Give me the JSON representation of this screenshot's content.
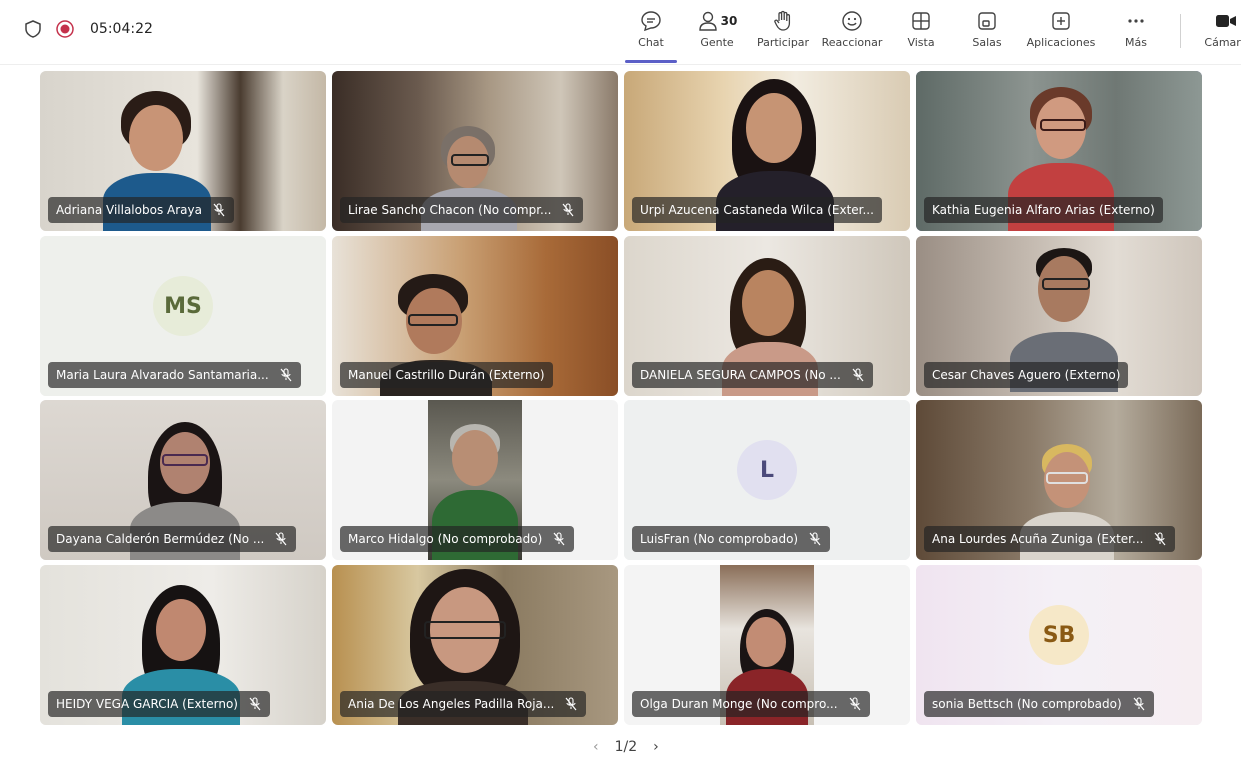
{
  "header": {
    "timer": "05:04:22",
    "people_count": "30",
    "toolbar": [
      {
        "label": "Chat",
        "icon": "chat-icon"
      },
      {
        "label": "Gente",
        "icon": "people-icon"
      },
      {
        "label": "Participar",
        "icon": "raise-hand-icon"
      },
      {
        "label": "Reaccionar",
        "icon": "react-icon"
      },
      {
        "label": "Vista",
        "icon": "view-icon"
      },
      {
        "label": "Salas",
        "icon": "rooms-icon"
      },
      {
        "label": "Aplicaciones",
        "icon": "apps-icon"
      },
      {
        "label": "Más",
        "icon": "more-icon"
      },
      {
        "label": "Cámara",
        "icon": "camera-icon"
      }
    ]
  },
  "participants": [
    {
      "name": "Adriana Villalobos Araya",
      "muted": true
    },
    {
      "name": "Lirae Sancho Chacon (No compr...",
      "muted": true
    },
    {
      "name": "Urpi Azucena Castaneda Wilca (Exter...",
      "muted": false
    },
    {
      "name": "Kathia Eugenia Alfaro Arias (Externo)",
      "muted": false
    },
    {
      "name": "Maria Laura Alvarado Santamaria...",
      "muted": true,
      "initials": "MS"
    },
    {
      "name": "Manuel Castrillo Durán (Externo)",
      "muted": false
    },
    {
      "name": "DANIELA SEGURA CAMPOS (No ...",
      "muted": true
    },
    {
      "name": "Cesar Chaves Aguero (Externo)",
      "muted": false
    },
    {
      "name": "Dayana Calderón Bermúdez (No ...",
      "muted": true
    },
    {
      "name": "Marco Hidalgo (No comprobado)",
      "muted": true
    },
    {
      "name": "LuisFran (No comprobado)",
      "muted": true,
      "initials": "L"
    },
    {
      "name": "Ana Lourdes Acuña Zuniga (Exter...",
      "muted": true
    },
    {
      "name": "HEIDY VEGA GARCIA (Externo)",
      "muted": true
    },
    {
      "name": "Ania De Los Angeles Padilla Roja...",
      "muted": true
    },
    {
      "name": "Olga Duran Monge (No compro...",
      "muted": true
    },
    {
      "name": "sonia Bettsch (No comprobado)",
      "muted": true,
      "initials": "SB"
    }
  ],
  "pagination": {
    "current": "1/2"
  }
}
